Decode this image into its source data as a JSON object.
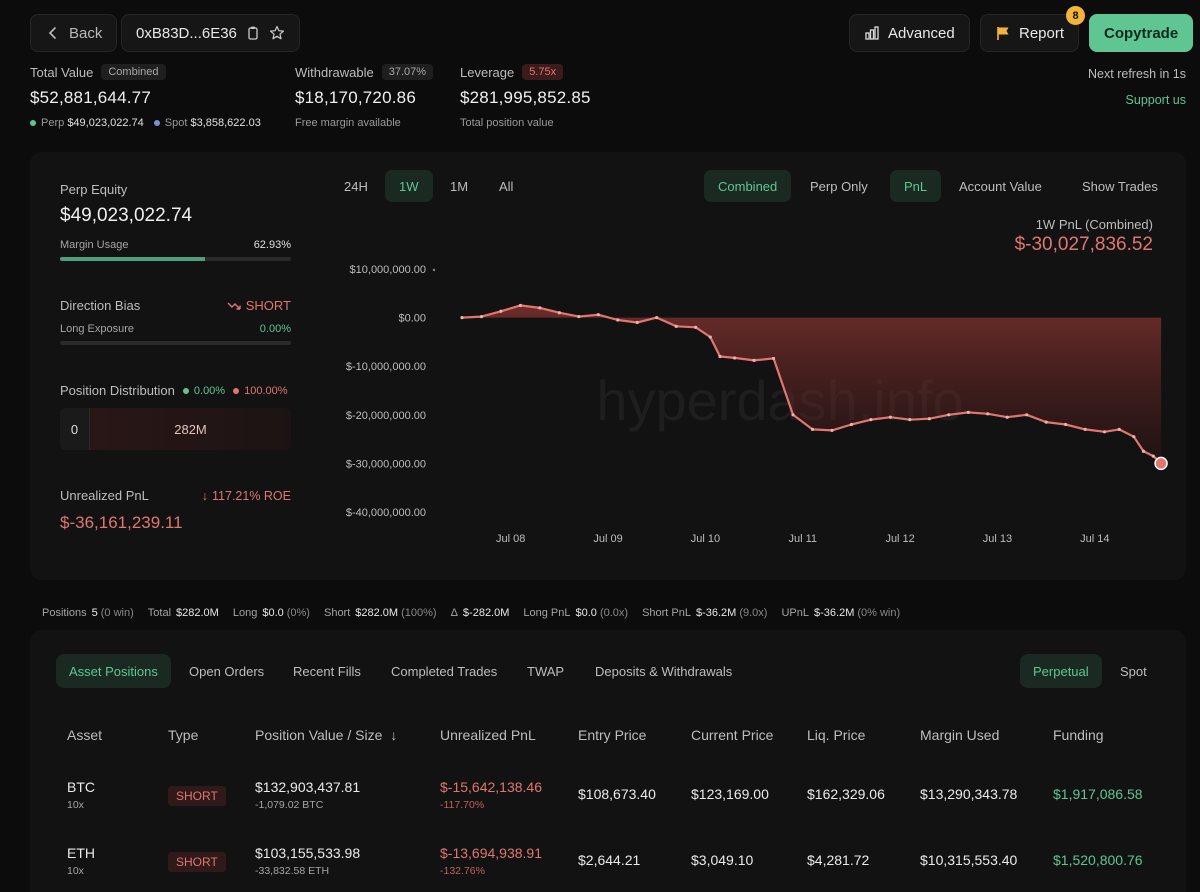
{
  "header": {
    "back_label": "Back",
    "address": "0xB83D...6E36",
    "advanced_label": "Advanced",
    "report_label": "Report",
    "report_badge": "8",
    "copytrade_label": "Copytrade"
  },
  "stats": {
    "total_value": {
      "label": "Total Value",
      "pill": "Combined",
      "value": "$52,881,644.77",
      "perp_label": "Perp",
      "perp_value": "$49,023,022.74",
      "spot_label": "Spot",
      "spot_value": "$3,858,622.03"
    },
    "withdrawable": {
      "label": "Withdrawable",
      "pill": "37.07%",
      "value": "$18,170,720.86",
      "sub": "Free margin available"
    },
    "leverage": {
      "label": "Leverage",
      "pill": "5.75x",
      "value": "$281,995,852.85",
      "sub": "Total position value"
    },
    "refresh": "Next refresh in 1s",
    "support": "Support us"
  },
  "left_panel": {
    "perp_equity_label": "Perp Equity",
    "perp_equity_value": "$49,023,022.74",
    "margin_usage_label": "Margin Usage",
    "margin_usage_value": "62.93%",
    "margin_usage_fraction": 0.6293,
    "direction_label": "Direction Bias",
    "direction_value": "SHORT",
    "long_exposure_label": "Long Exposure",
    "long_exposure_value": "0.00%",
    "distribution_label": "Position Distribution",
    "dist_long_pct": "0.00%",
    "dist_short_pct": "100.00%",
    "dist_long_value": "0",
    "dist_short_value": "282M",
    "unrealized_label": "Unrealized PnL",
    "roe": "117.21% ROE",
    "unrealized_value": "$-36,161,239.11"
  },
  "chart_controls": {
    "ranges": [
      "24H",
      "1W",
      "1M",
      "All"
    ],
    "active_range": "1W",
    "modes": [
      "Combined",
      "Perp Only"
    ],
    "views": [
      "PnL",
      "Account Value"
    ],
    "show_trades": "Show Trades",
    "title": "1W PnL (Combined)",
    "value": "$-30,027,836.52",
    "watermark": "hyperdash.info"
  },
  "chart_data": {
    "type": "area",
    "title": "1W PnL (Combined)",
    "y_tick_labels": [
      "$10,000,000.00",
      "$0.00",
      "$-10,000,000.00",
      "$-20,000,000.00",
      "$-30,000,000.00",
      "$-40,000,000.00"
    ],
    "y_ticks": [
      10000000,
      0,
      -10000000,
      -20000000,
      -30000000,
      -40000000
    ],
    "ylim": [
      -40000000,
      10000000
    ],
    "x_tick_labels": [
      "Jul 08",
      "Jul 09",
      "Jul 10",
      "Jul 11",
      "Jul 12",
      "Jul 13",
      "Jul 14"
    ],
    "x_tick_positions": [
      0.5,
      1.5,
      2.5,
      3.5,
      4.5,
      5.5,
      6.5
    ],
    "xlim": [
      0,
      7.2
    ],
    "x": [
      0,
      0.2,
      0.4,
      0.6,
      0.8,
      1.0,
      1.2,
      1.4,
      1.6,
      1.8,
      2.0,
      2.2,
      2.4,
      2.55,
      2.65,
      2.8,
      3.0,
      3.2,
      3.4,
      3.6,
      3.8,
      4.0,
      4.2,
      4.4,
      4.6,
      4.8,
      5.0,
      5.2,
      5.4,
      5.6,
      5.8,
      6.0,
      6.2,
      6.4,
      6.6,
      6.75,
      6.9,
      7.0,
      7.1,
      7.18
    ],
    "y": [
      0,
      200000,
      1300000,
      2500000,
      2000000,
      1000000,
      200000,
      600000,
      -500000,
      -1000000,
      0,
      -1800000,
      -2000000,
      -4000000,
      -8000000,
      -8300000,
      -8800000,
      -8400000,
      -20000000,
      -23000000,
      -23200000,
      -22000000,
      -21000000,
      -20500000,
      -21000000,
      -20800000,
      -20000000,
      -19500000,
      -19800000,
      -20500000,
      -20000000,
      -21500000,
      -22000000,
      -23000000,
      -23500000,
      -23000000,
      -24500000,
      -27500000,
      -28500000,
      -30000000
    ],
    "series": [
      {
        "values_ref": "y",
        "color": "#e0766f"
      }
    ],
    "grid": false
  },
  "summary": {
    "positions_label": "Positions",
    "positions_value": "5",
    "positions_meta": "(0 win)",
    "total_label": "Total",
    "total_value": "$282.0M",
    "long_label": "Long",
    "long_value": "$0.0",
    "long_meta": "(0%)",
    "short_label": "Short",
    "short_value": "$282.0M",
    "short_meta": "(100%)",
    "delta_label": "Δ",
    "delta_value": "$-282.0M",
    "longpnl_label": "Long PnL",
    "longpnl_value": "$0.0",
    "longpnl_meta": "(0.0x)",
    "shortpnl_label": "Short PnL",
    "shortpnl_value": "$-36.2M",
    "shortpnl_meta": "(9.0x)",
    "upnl_label": "UPnL",
    "upnl_value": "$-36.2M",
    "upnl_meta": "(0% win)"
  },
  "bottom_tabs": [
    "Asset Positions",
    "Open Orders",
    "Recent Fills",
    "Completed Trades",
    "TWAP",
    "Deposits & Withdrawals"
  ],
  "market_tabs": [
    "Perpetual",
    "Spot"
  ],
  "table": {
    "columns": [
      "Asset",
      "Type",
      "Position Value / Size",
      "Unrealized PnL",
      "Entry Price",
      "Current Price",
      "Liq. Price",
      "Margin Used",
      "Funding"
    ],
    "sort_icon": "arrow-down-icon",
    "rows": [
      {
        "asset": "BTC",
        "leverage": "10x",
        "type": "SHORT",
        "value": "$132,903,437.81",
        "size": "-1,079.02 BTC",
        "upnl": "$-15,642,138.46",
        "upnl_pct": "-117.70%",
        "entry": "$108,673.40",
        "current": "$123,169.00",
        "liq": "$162,329.06",
        "margin": "$13,290,343.78",
        "funding": "$1,917,086.58"
      },
      {
        "asset": "ETH",
        "leverage": "10x",
        "type": "SHORT",
        "value": "$103,155,533.98",
        "size": "-33,832.58 ETH",
        "upnl": "$-13,694,938.91",
        "upnl_pct": "-132.76%",
        "entry": "$2,644.21",
        "current": "$3,049.10",
        "liq": "$4,281.72",
        "margin": "$10,315,553.40",
        "funding": "$1,520,800.76"
      }
    ]
  },
  "colors": {
    "accent": "#5fc593",
    "negative": "#e0766f",
    "badge": "#f2b53a",
    "background": "#0c0c0c"
  }
}
